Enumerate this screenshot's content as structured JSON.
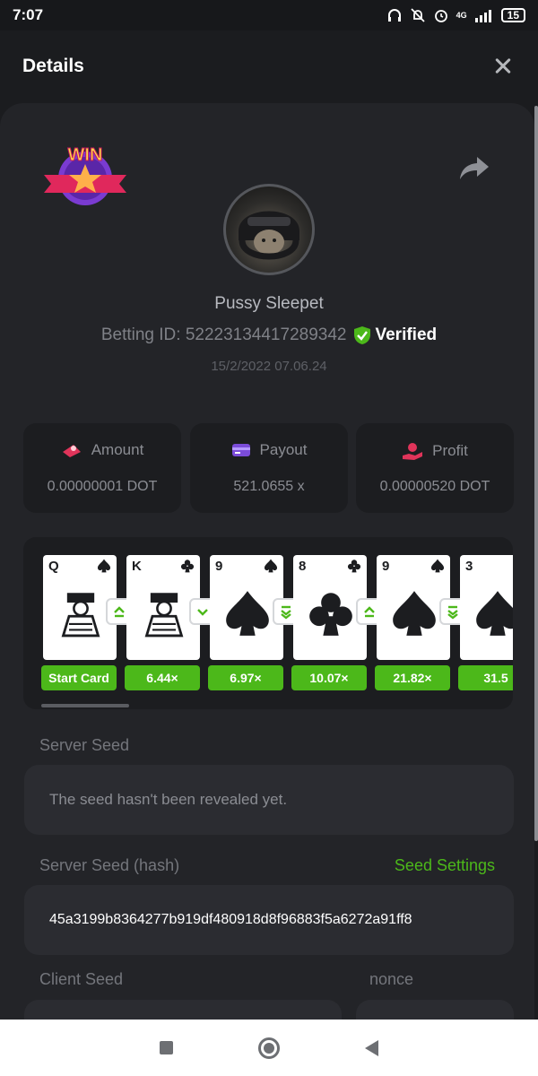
{
  "statusbar": {
    "time": "7:07",
    "battery": "15",
    "network": "4G"
  },
  "header": {
    "title": "Details"
  },
  "badge": {
    "text": "WIN"
  },
  "player": {
    "name": "Pussy Sleepet",
    "betting_id": "Betting ID: 52223134417289342",
    "verified": "Verified",
    "date": "15/2/2022 07.06.24"
  },
  "stats": {
    "amount": {
      "label": "Amount",
      "value": "0.00000001 DOT"
    },
    "payout": {
      "label": "Payout",
      "value": "521.0655 x"
    },
    "profit": {
      "label": "Profit",
      "value": "0.00000520 DOT"
    }
  },
  "cards": [
    {
      "rank": "Q",
      "suit": "spade",
      "multiplier": "Start Card",
      "arrow": "up"
    },
    {
      "rank": "K",
      "suit": "club",
      "multiplier": "6.44×",
      "arrow": "down"
    },
    {
      "rank": "9",
      "suit": "spade",
      "multiplier": "6.97×",
      "arrow": "down-double"
    },
    {
      "rank": "8",
      "suit": "club",
      "multiplier": "10.07×",
      "arrow": "up"
    },
    {
      "rank": "9",
      "suit": "spade",
      "multiplier": "21.82×",
      "arrow": "down-double"
    },
    {
      "rank": "3",
      "suit": "spade",
      "multiplier": "31.5"
    }
  ],
  "server_seed": {
    "label": "Server Seed",
    "placeholder": "The seed hasn't been revealed yet."
  },
  "server_seed_hash": {
    "label": "Server Seed (hash)",
    "settings_link": "Seed Settings",
    "value": "45a3199b8364277b919df480918d8f96883f5a6272a91ff8"
  },
  "client_seed": {
    "label": "Client Seed"
  },
  "nonce": {
    "label": "nonce"
  },
  "colors": {
    "accent": "#4cb81a",
    "background": "#1b1c1f",
    "card": "#232428"
  }
}
